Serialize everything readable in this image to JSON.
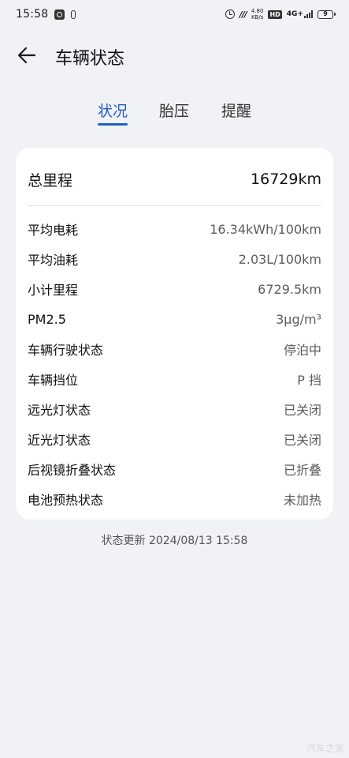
{
  "status_bar": {
    "time": "15:58",
    "speed_value": "4.80",
    "speed_unit": "KB/s",
    "hd": "HD",
    "network": "4G+",
    "battery": "9"
  },
  "header": {
    "title": "车辆状态"
  },
  "tabs": [
    {
      "label": "状况",
      "active": true
    },
    {
      "label": "胎压",
      "active": false
    },
    {
      "label": "提醒",
      "active": false
    }
  ],
  "summary": {
    "label": "总里程",
    "value": "16729km"
  },
  "rows": [
    {
      "label": "平均电耗",
      "value": "16.34kWh/100km"
    },
    {
      "label": "平均油耗",
      "value": "2.03L/100km"
    },
    {
      "label": "小计里程",
      "value": "6729.5km"
    },
    {
      "label": "PM2.5",
      "value": "3μg/m³"
    },
    {
      "label": "车辆行驶状态",
      "value": "停泊中"
    },
    {
      "label": "车辆挡位",
      "value": "P 挡"
    },
    {
      "label": "远光灯状态",
      "value": "已关闭"
    },
    {
      "label": "近光灯状态",
      "value": "已关闭"
    },
    {
      "label": "后视镜折叠状态",
      "value": "已折叠"
    },
    {
      "label": "电池预热状态",
      "value": "未加热"
    }
  ],
  "footer": {
    "update_text": "状态更新 2024/08/13 15:58"
  },
  "watermark": "汽车之家",
  "colors": {
    "accent": "#1f5fc8",
    "background": "#f1f2f6",
    "card": "#ffffff"
  }
}
